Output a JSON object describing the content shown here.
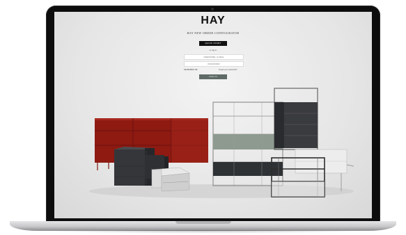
{
  "login": {
    "logo": "HAY",
    "subtitle": "HAY NEW ORDER CONFIGURATOR",
    "quick_start_label": "QUICK START",
    "or_label": "or log in",
    "username_placeholder": "USERNAME / E-MAIL",
    "password_placeholder": "PASSWORD",
    "remember_label": "REMEMBER ME",
    "forgot_label": "Forgot your password?",
    "login_label": "LOG IN"
  },
  "colors": {
    "shelf_red": "#8e1a12",
    "shelf_dark": "#35363a",
    "shelf_green": "#8e9a90",
    "button_dark": "#111111",
    "button_green": "#5f6b66"
  }
}
